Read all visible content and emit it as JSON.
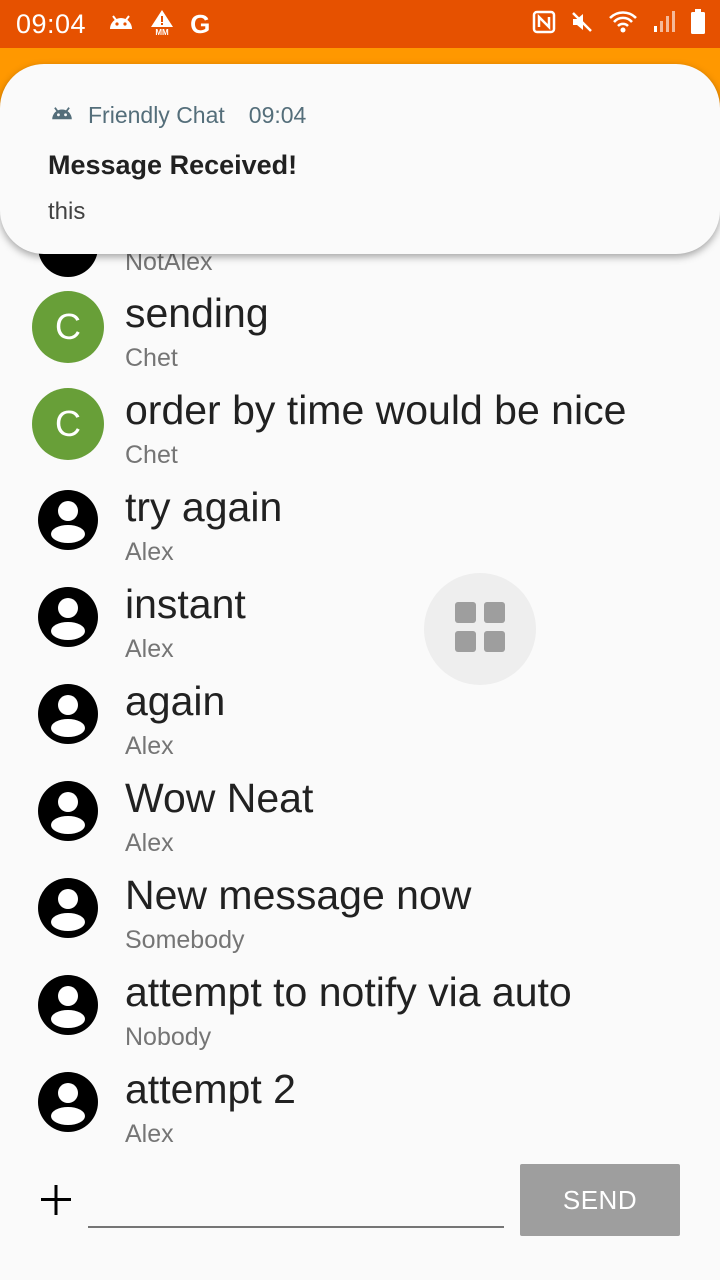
{
  "status_bar": {
    "time": "09:04",
    "carrier_icon_text": "G",
    "icons_left": [
      "android-icon",
      "warning-mm-icon",
      "g-icon"
    ],
    "icons_right": [
      "nfc-icon",
      "mute-icon",
      "wifi-icon",
      "signal-icon",
      "battery-icon"
    ],
    "color": "#e65100"
  },
  "notification": {
    "app_name": "Friendly Chat",
    "time": "09:04",
    "title": "Message Received!",
    "body": "this"
  },
  "messages": [
    {
      "text": "",
      "sender": "NotAlex",
      "avatar": "default"
    },
    {
      "text": "sending",
      "sender": "Chet",
      "avatar": "letter",
      "letter": "C"
    },
    {
      "text": "order by time would be nice",
      "sender": "Chet",
      "avatar": "letter",
      "letter": "C"
    },
    {
      "text": "try again",
      "sender": "Alex",
      "avatar": "default"
    },
    {
      "text": "instant",
      "sender": "Alex",
      "avatar": "default"
    },
    {
      "text": "again",
      "sender": "Alex",
      "avatar": "default"
    },
    {
      "text": "Wow Neat",
      "sender": "Alex",
      "avatar": "default"
    },
    {
      "text": "New message now",
      "sender": "Somebody",
      "avatar": "default"
    },
    {
      "text": "attempt to notify via auto",
      "sender": "Nobody",
      "avatar": "default"
    },
    {
      "text": "attempt 2",
      "sender": "Alex",
      "avatar": "default"
    }
  ],
  "composer": {
    "add_symbol": "+",
    "input_value": "",
    "send_label": "SEND"
  },
  "colors": {
    "accent": "#ff9800",
    "letter_avatar": "#689f38",
    "send_disabled": "#9e9e9e"
  }
}
